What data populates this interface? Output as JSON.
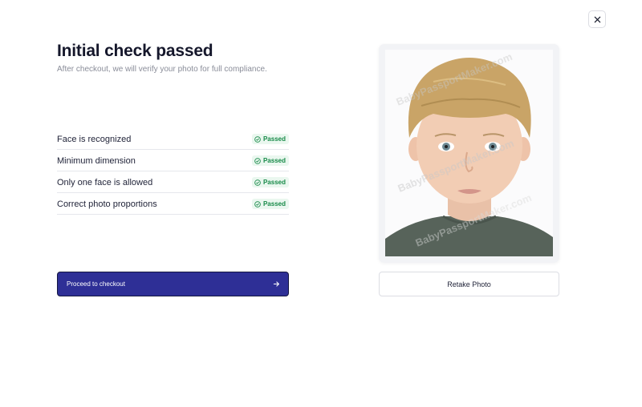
{
  "header": {
    "title": "Initial check passed",
    "subtitle": "After checkout, we will verify your photo for full compliance."
  },
  "checks": [
    {
      "label": "Face is recognized",
      "status": "Passed"
    },
    {
      "label": "Minimum dimension",
      "status": "Passed"
    },
    {
      "label": "Only one face is allowed",
      "status": "Passed"
    },
    {
      "label": "Correct photo proportions",
      "status": "Passed"
    }
  ],
  "actions": {
    "proceed_label": "Proceed to checkout",
    "retake_label": "Retake Photo"
  },
  "photo": {
    "watermark": "BabyPassportMaker.com"
  },
  "icons": {
    "close": "close-icon",
    "check": "check-circle-icon",
    "arrow": "arrow-right-icon"
  },
  "colors": {
    "primary": "#2e2f96",
    "passed_text": "#178a48",
    "passed_bg": "#eaf7ef"
  }
}
